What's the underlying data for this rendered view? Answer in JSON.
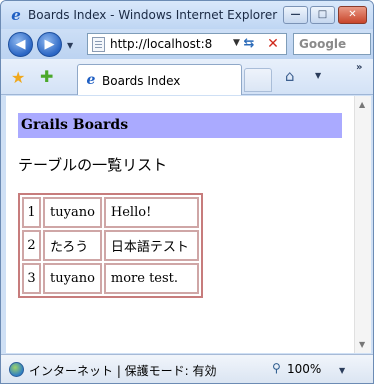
{
  "window": {
    "title": "Boards Index - Windows Internet Explorer",
    "minimize_glyph": "—",
    "maximize_glyph": "□",
    "close_glyph": "✕"
  },
  "address_bar": {
    "url": "http://localhost:8",
    "search_placeholder": "Google"
  },
  "tabs": [
    {
      "label": "Boards Index",
      "active": true
    }
  ],
  "page": {
    "heading": "Grails Boards",
    "subtitle": "テーブルの一覧リスト",
    "table": {
      "rows": [
        {
          "id": "1",
          "name": "tuyano",
          "message": "Hello!"
        },
        {
          "id": "2",
          "name": "たろう",
          "message": "日本語テスト"
        },
        {
          "id": "3",
          "name": "tuyano",
          "message": "more test."
        }
      ]
    }
  },
  "status_bar": {
    "zone_text": "インターネット | 保護モード: 有効",
    "zoom": "100%"
  },
  "colors": {
    "heading_bg": "#aaaaff",
    "table_border": "#c77c7c"
  }
}
